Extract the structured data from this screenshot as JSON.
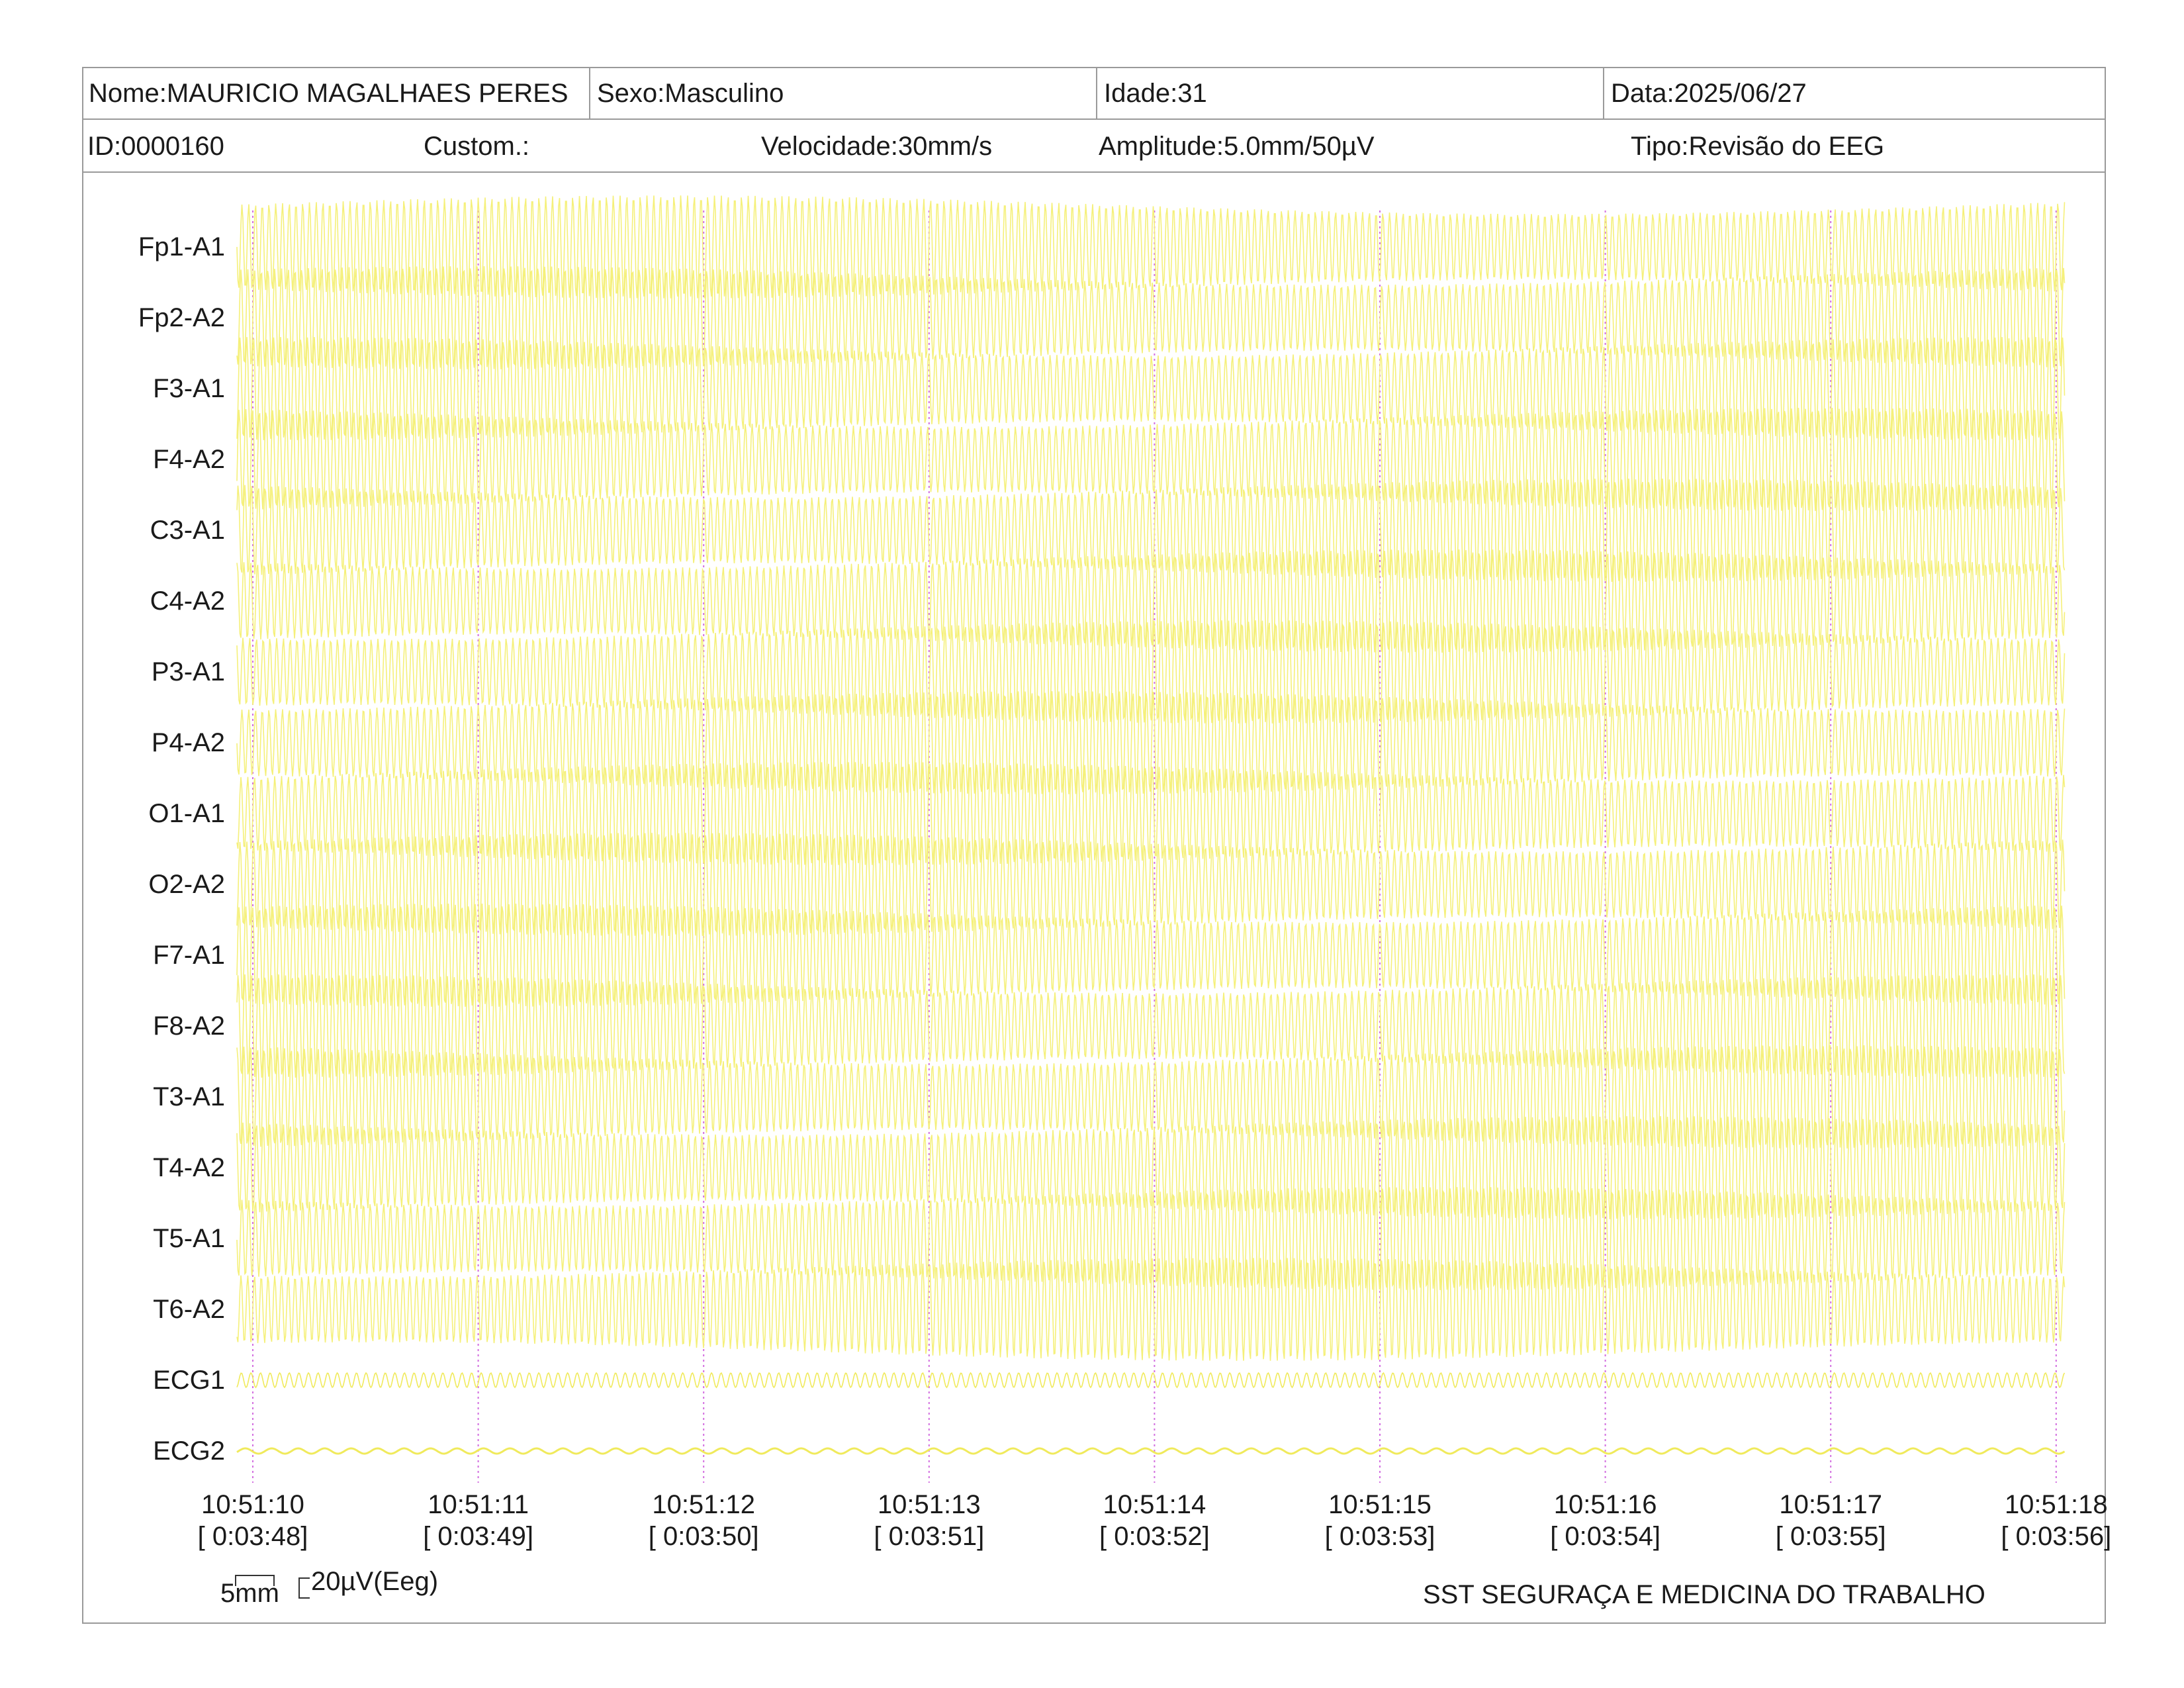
{
  "header": {
    "name": "Nome:MAURICIO MAGALHAES PERES",
    "sex": "Sexo:Masculino",
    "age": "Idade:31",
    "date": "Data:2025/06/27",
    "id": "ID:0000160",
    "custom": "Custom.:",
    "speed": "Velocidade:30mm/s",
    "amplitude": "Amplitude:5.0mm/50µV",
    "type": "Tipo:Revisão do EEG"
  },
  "channels": [
    "Fp1-A1",
    "Fp2-A2",
    "F3-A1",
    "F4-A2",
    "C3-A1",
    "C4-A2",
    "P3-A1",
    "P4-A2",
    "O1-A1",
    "O2-A2",
    "F7-A1",
    "F8-A2",
    "T3-A1",
    "T4-A2",
    "T5-A1",
    "T6-A2",
    "ECG1",
    "ECG2"
  ],
  "time_ticks": [
    {
      "time": "10:51:10",
      "elapsed": "[ 0:03:48]"
    },
    {
      "time": "10:51:11",
      "elapsed": "[ 0:03:49]"
    },
    {
      "time": "10:51:12",
      "elapsed": "[ 0:03:50]"
    },
    {
      "time": "10:51:13",
      "elapsed": "[ 0:03:51]"
    },
    {
      "time": "10:51:14",
      "elapsed": "[ 0:03:52]"
    },
    {
      "time": "10:51:15",
      "elapsed": "[ 0:03:53]"
    },
    {
      "time": "10:51:16",
      "elapsed": "[ 0:03:54]"
    },
    {
      "time": "10:51:17",
      "elapsed": "[ 0:03:55]"
    },
    {
      "time": "10:51:18",
      "elapsed": "[ 0:03:56]"
    }
  ],
  "scale": {
    "time_scale": "5mm",
    "amp_scale": "20µV(Eeg)"
  },
  "footer": {
    "company": "SST SEGURAÇA E MEDICINA DO TRABALHO"
  },
  "colors": {
    "trace": "#f5f07a",
    "trace_ecg": "#f0ea5c",
    "second_marker": "#d36ee0",
    "border": "#9a9a9a"
  }
}
